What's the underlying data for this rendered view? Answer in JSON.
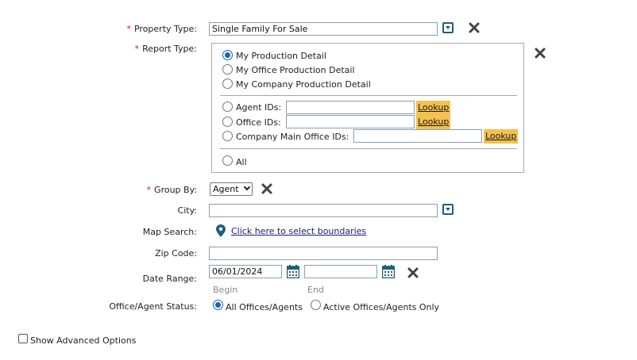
{
  "property_type": {
    "label": "Property Type:",
    "value": "Single Family For Sale"
  },
  "report_type": {
    "label": "Report Type:",
    "options": [
      {
        "label": "My Production Detail",
        "selected": true
      },
      {
        "label": "My Office Production Detail",
        "selected": false
      },
      {
        "label": "My Company Production Detail",
        "selected": false
      }
    ],
    "agent_ids_label": "Agent IDs:",
    "office_ids_label": "Office IDs:",
    "company_main_office_ids_label": "Company Main Office IDs:",
    "lookup_label": "Lookup",
    "all_label": "All"
  },
  "group_by": {
    "label": "Group By:",
    "value": "Agent"
  },
  "city": {
    "label": "City:",
    "value": ""
  },
  "map_search": {
    "label": "Map Search:",
    "link": "Click here to select boundaries"
  },
  "zip_code": {
    "label": "Zip Code:",
    "value": ""
  },
  "date_range": {
    "label": "Date Range:",
    "begin_value": "06/01/2024",
    "end_value": "",
    "begin_hint": "Begin",
    "end_hint": "End"
  },
  "status": {
    "label": "Office/Agent Status:",
    "options": [
      {
        "label": "All Offices/Agents",
        "selected": true
      },
      {
        "label": "Active Offices/Agents Only",
        "selected": false
      }
    ]
  },
  "advanced": {
    "label": "Show Advanced Options",
    "checked": false
  },
  "colors": {
    "required": "#d21f1f",
    "icon_teal": "#1f5f7a",
    "lookup_bg": "#f4c04e",
    "radio_selected": "#1a63b4"
  },
  "icons": [
    "chevron-down-icon",
    "close-icon",
    "map-pin-icon",
    "calendar-icon"
  ]
}
